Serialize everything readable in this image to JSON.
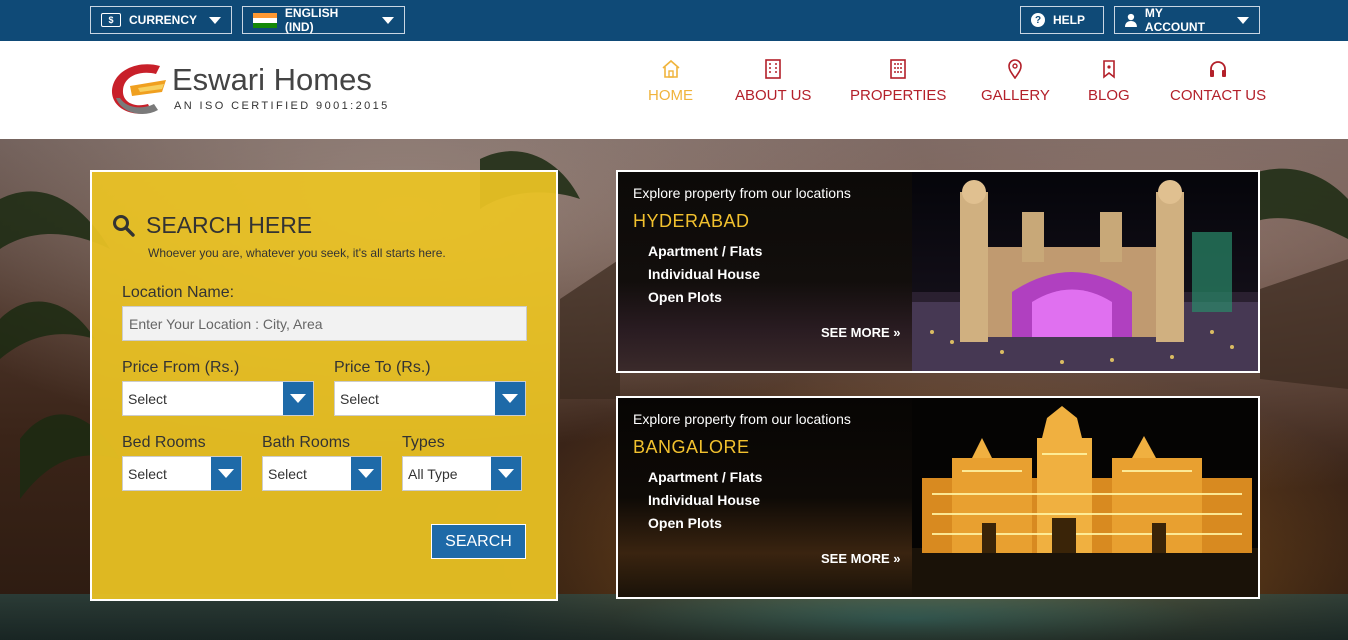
{
  "topbar": {
    "currency_label": "CURRENCY",
    "language_label": "ENGLISH (IND)",
    "help_label": "HELP",
    "account_label": "MY ACCOUNT"
  },
  "brand": {
    "name": "Eswari Homes",
    "tagline": "AN ISO CERTIFIED 9001:2015",
    "primary_color": "#b3202a",
    "accent_color": "#f0b43c",
    "topbar_color": "#0f4a77"
  },
  "nav": {
    "items": [
      {
        "label": "HOME",
        "icon": "home-icon",
        "active": true
      },
      {
        "label": "ABOUT US",
        "icon": "building-icon"
      },
      {
        "label": "PROPERTIES",
        "icon": "apartment-icon"
      },
      {
        "label": "GALLERY",
        "icon": "map-pin-icon"
      },
      {
        "label": "BLOG",
        "icon": "bookmark-icon"
      },
      {
        "label": "CONTACT US",
        "icon": "headphones-icon"
      }
    ]
  },
  "search": {
    "title": "SEARCH HERE",
    "subtitle": "Whoever you are, whatever you seek, it's all starts here.",
    "location_label": "Location Name:",
    "location_placeholder": "Enter Your Location : City, Area",
    "price_from_label": "Price From (Rs.)",
    "price_from_value": "Select",
    "price_to_label": "Price To (Rs.)",
    "price_to_value": "Select",
    "bed_label": "Bed Rooms",
    "bed_value": "Select",
    "bath_label": "Bath Rooms",
    "bath_value": "Select",
    "types_label": "Types",
    "types_value": "All Type",
    "button_label": "SEARCH"
  },
  "locations": [
    {
      "explore": "Explore property from our locations",
      "city": "HYDERABAD",
      "types": [
        "Apartment / Flats",
        "Individual House",
        "Open Plots"
      ],
      "more": "SEE MORE »"
    },
    {
      "explore": "Explore property from our locations",
      "city": "BANGALORE",
      "types": [
        "Apartment / Flats",
        "Individual House",
        "Open Plots"
      ],
      "more": "SEE MORE »"
    }
  ]
}
